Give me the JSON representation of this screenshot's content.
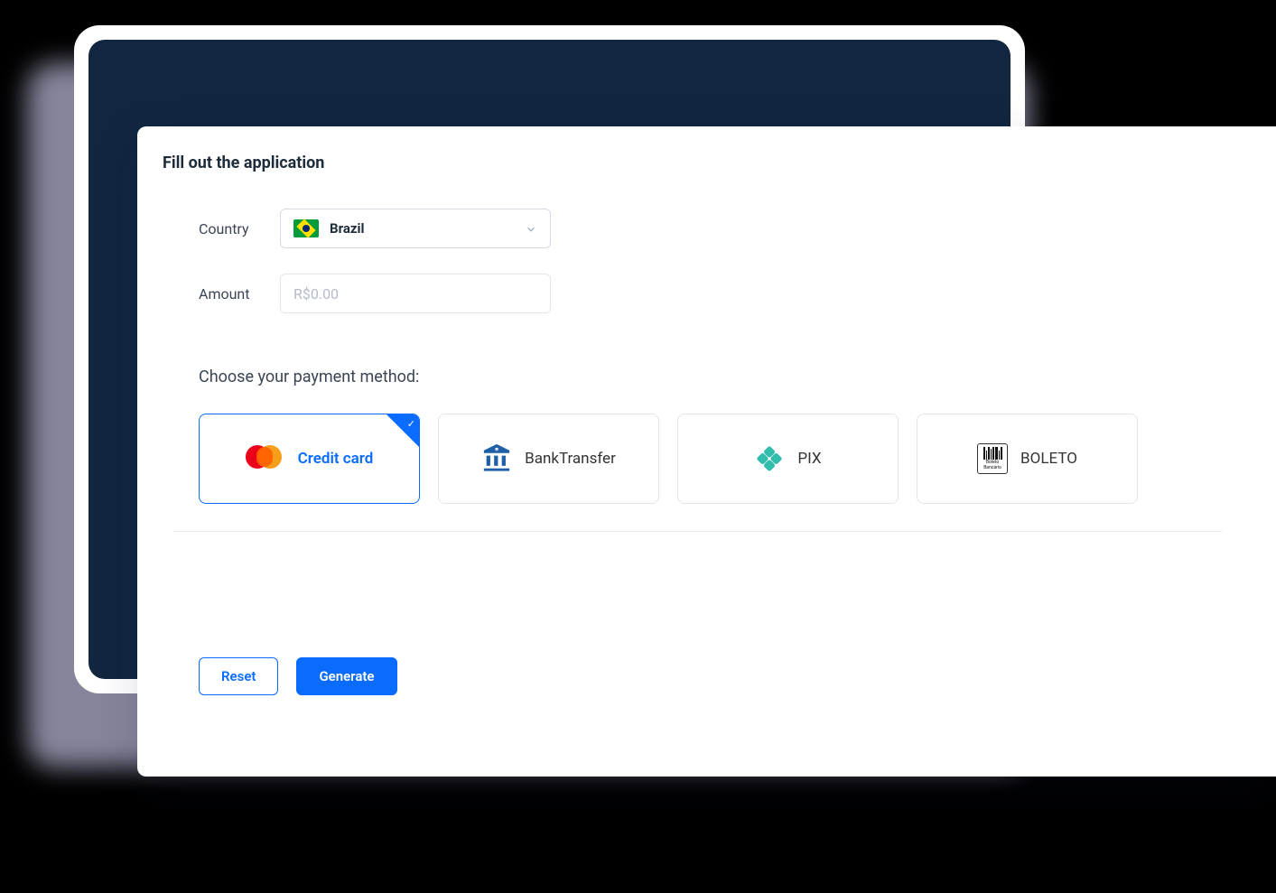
{
  "title": "Fill out the application",
  "form": {
    "country_label": "Country",
    "country_value": "Brazil",
    "amount_label": "Amount",
    "amount_placeholder": "R$0.00"
  },
  "payment": {
    "choose_label": "Choose your payment method:",
    "methods": [
      {
        "label": "Credit card",
        "selected": true
      },
      {
        "label": "BankTransfer",
        "selected": false
      },
      {
        "label": "PIX",
        "selected": false
      },
      {
        "label": "BOLETO",
        "selected": false
      }
    ]
  },
  "boleto_text": {
    "l1": "Boleto",
    "l2": "Bancário"
  },
  "buttons": {
    "reset": "Reset",
    "generate": "Generate"
  },
  "colors": {
    "primary": "#0a6bff",
    "dark_panel": "#12263f"
  }
}
